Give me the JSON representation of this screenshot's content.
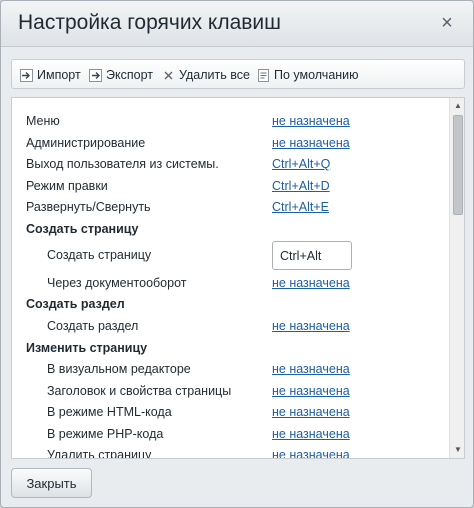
{
  "dialog": {
    "title": "Настройка горячих клавиш",
    "close_glyph": "×"
  },
  "toolbar": {
    "import_label": "Импорт",
    "export_label": "Экспорт",
    "delete_all_label": "Удалить все",
    "default_label": "По умолчанию"
  },
  "rows": [
    {
      "label": "Меню",
      "value": "не назначена"
    },
    {
      "label": "Администрирование",
      "value": "не назначена"
    },
    {
      "label": "Выход пользователя из системы.",
      "value": "Ctrl+Alt+Q"
    },
    {
      "label": "Режим правки",
      "value": "Ctrl+Alt+D"
    },
    {
      "label": "Развернуть/Свернуть",
      "value": "Ctrl+Alt+E"
    },
    {
      "label": "Создать страницу"
    },
    {
      "label": "Создать страницу",
      "input_value": "Ctrl+Alt"
    },
    {
      "label": "Через документооборот",
      "value": "не назначена"
    },
    {
      "label": "Создать раздел"
    },
    {
      "label": "Создать раздел",
      "value": "не назначена"
    },
    {
      "label": "Изменить страницу"
    },
    {
      "label": "В визуальном редакторе",
      "value": "не назначена"
    },
    {
      "label": "Заголовок и свойства страницы",
      "value": "не назначена"
    },
    {
      "label": "В режиме HTML-кода",
      "value": "не назначена"
    },
    {
      "label": "В режиме PHP-кода",
      "value": "не назначена"
    },
    {
      "label": "Удалить страницу",
      "value": "не назначена"
    }
  ],
  "footer": {
    "close_button_label": "Закрыть"
  },
  "icons": {
    "import": "import-icon",
    "export": "export-icon",
    "delete_all": "delete-icon",
    "default": "default-icon"
  }
}
